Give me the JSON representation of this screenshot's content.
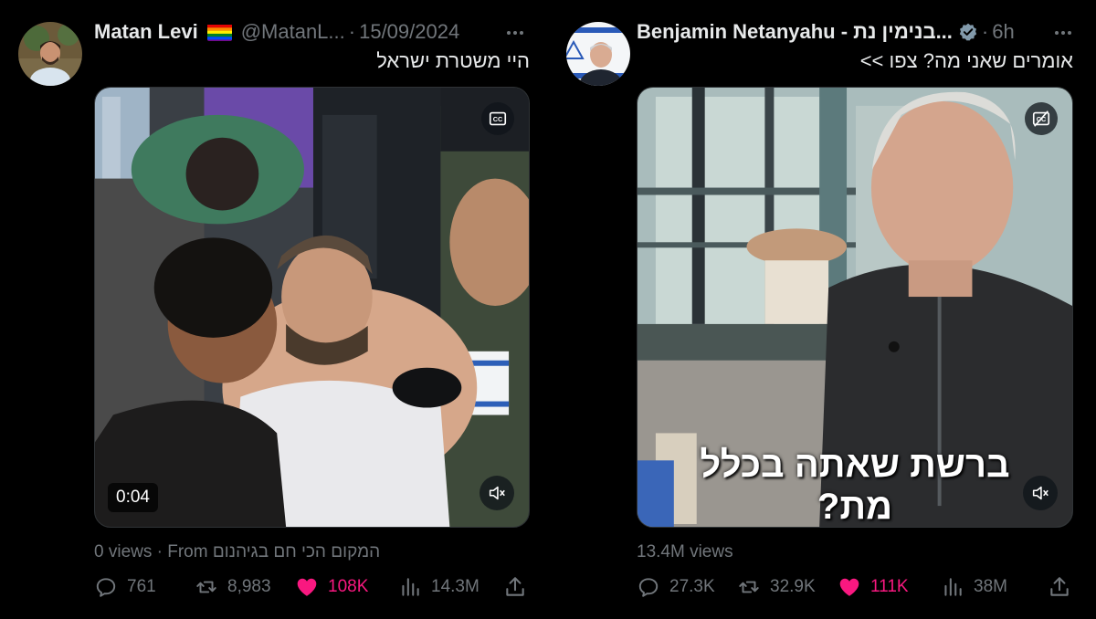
{
  "colors": {
    "background": "#000000",
    "text_primary": "#e7e9ea",
    "text_secondary": "#71767b",
    "like_active": "#f91880",
    "verified_badge": "#829aab"
  },
  "tweets": [
    {
      "author_name": "Matan Levi",
      "author_emoji": "rainbow-flag",
      "handle": "@MatanL...",
      "separator": "·",
      "date": "15/09/2024",
      "text": "היי משטרת ישראל",
      "media": {
        "type": "video",
        "timestamp": "0:04",
        "caption_badge": "CC",
        "muted": true
      },
      "views": "0 views",
      "from_prefix": "· From",
      "from_text": "המקום הכי חם בגיהנום",
      "stats": {
        "replies": "761",
        "reposts": "8,983",
        "likes": "108K",
        "views": "14.3M"
      },
      "liked": true
    },
    {
      "author_name": "Benjamin Netanyahu - בנימין נת...",
      "verified": true,
      "separator": "·",
      "date": "6h",
      "text": "אומרים שאני מה? צפו >>",
      "media": {
        "type": "video",
        "subtitle_line1": "ברשת שאתה בכלל",
        "subtitle_line2": "מת?",
        "caption_badge": "CC-off",
        "muted": true
      },
      "views": "13.4M views",
      "stats": {
        "replies": "27.3K",
        "reposts": "32.9K",
        "likes": "111K",
        "views": "38M"
      },
      "liked": true
    }
  ]
}
